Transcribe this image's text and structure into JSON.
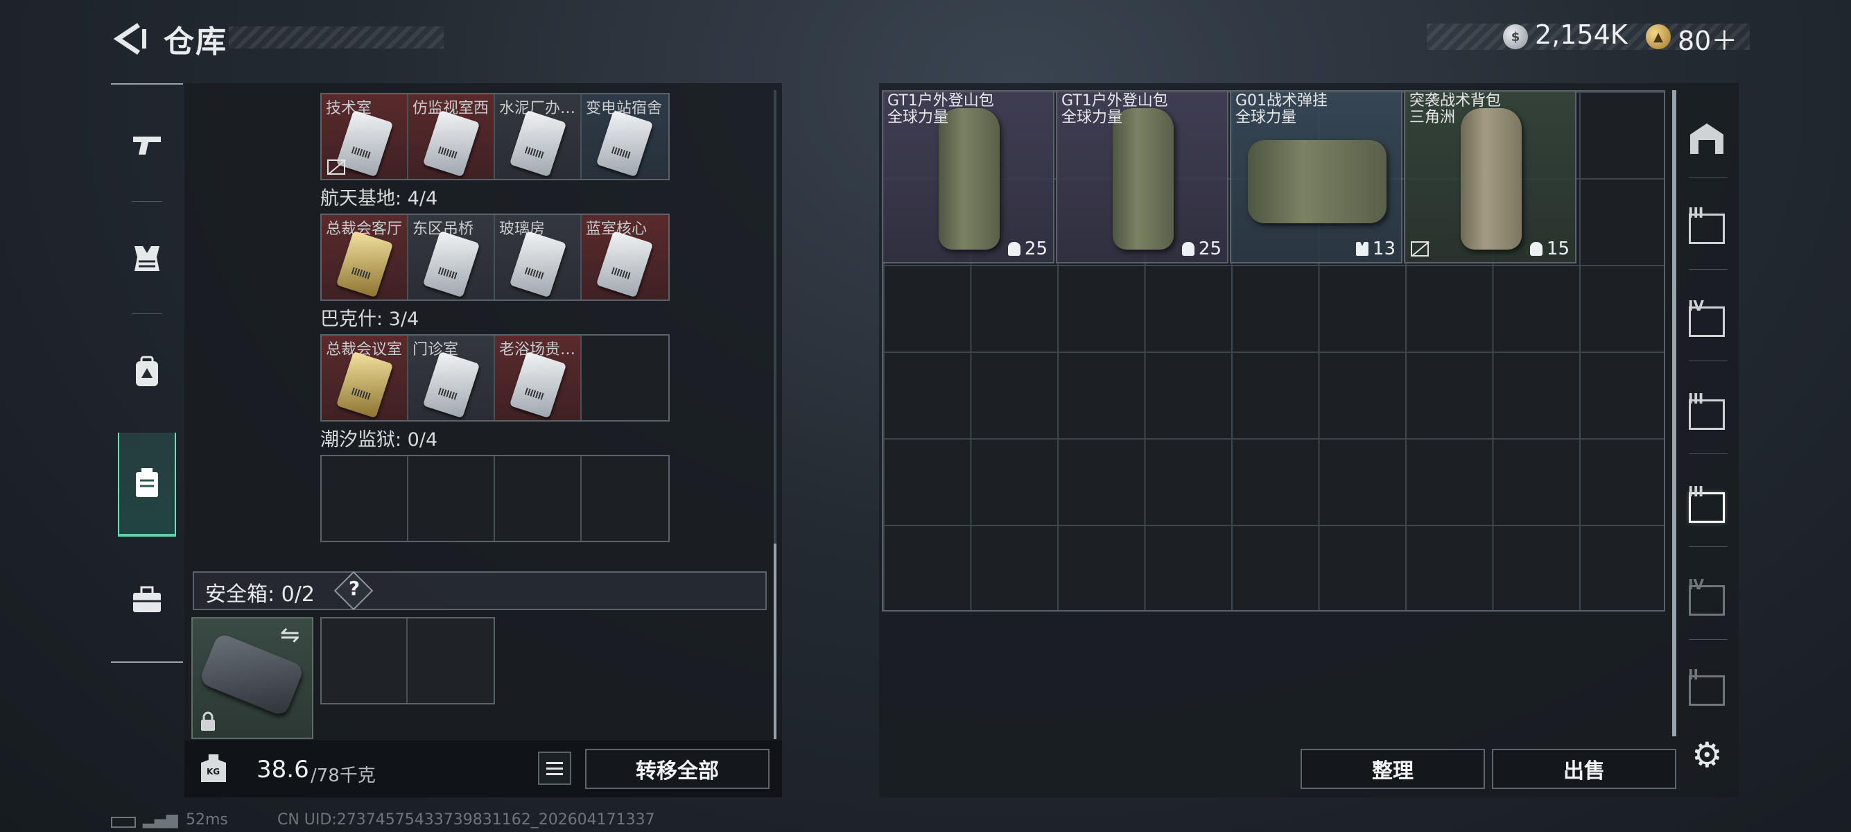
{
  "header": {
    "title": "仓库",
    "currency_silver_value": "2,154K",
    "currency_gold_value": "80＋"
  },
  "left_nav": [
    "gun-icon",
    "vest-icon",
    "backpack-icon",
    "keycard-case-icon",
    "toolbox-icon"
  ],
  "key_sections": [
    {
      "heading": "",
      "slots": [
        {
          "label": "技术室",
          "color": "red",
          "gold": false,
          "no_sell": true
        },
        {
          "label": "仿监视室西",
          "color": "red",
          "gold": false,
          "no_sell": false
        },
        {
          "label": "水泥厂办…",
          "color": "gray",
          "gold": false,
          "no_sell": false
        },
        {
          "label": "变电站宿舍",
          "color": "blue",
          "gold": false,
          "no_sell": false
        }
      ]
    },
    {
      "heading": "航天基地: 4/4",
      "slots": [
        {
          "label": "总裁会客厅",
          "color": "red",
          "gold": true
        },
        {
          "label": "东区吊桥",
          "color": "gray",
          "gold": false
        },
        {
          "label": "玻璃房",
          "color": "gray",
          "gold": false
        },
        {
          "label": "蓝室核心",
          "color": "red",
          "gold": false
        }
      ]
    },
    {
      "heading": "巴克什: 3/4",
      "slots": [
        {
          "label": "总裁会议室",
          "color": "red",
          "gold": true
        },
        {
          "label": "门诊室",
          "color": "gray",
          "gold": false
        },
        {
          "label": "老浴场贵…",
          "color": "red",
          "gold": false
        },
        {
          "label": "",
          "color": "empty",
          "gold": false
        }
      ]
    },
    {
      "heading": "潮汐监狱: 0/4",
      "slots": [
        {
          "label": "",
          "color": "empty"
        },
        {
          "label": "",
          "color": "empty"
        },
        {
          "label": "",
          "color": "empty"
        },
        {
          "label": "",
          "color": "empty"
        }
      ]
    }
  ],
  "safe_box": {
    "label": "安全箱:  0/2",
    "help": "?"
  },
  "weight": {
    "current": "38.6",
    "max": "/78千克",
    "unit_icon_text": "KG"
  },
  "buttons": {
    "transfer_all": "转移全部",
    "sort": "整理",
    "sell": "出售"
  },
  "stash_items": [
    {
      "name_line1": "GT1户外登山包",
      "name_line2": "全球力量",
      "capacity": "25",
      "color": "purple",
      "type": "backpack",
      "no_sell": false
    },
    {
      "name_line1": "GT1户外登山包",
      "name_line2": "全球力量",
      "capacity": "25",
      "color": "purple",
      "type": "backpack",
      "no_sell": false
    },
    {
      "name_line1": "G01战术弹挂",
      "name_line2": "全球力量",
      "capacity": "13",
      "color": "blue",
      "type": "vest",
      "no_sell": false
    },
    {
      "name_line1": "突袭战术背包",
      "name_line2": "三角洲",
      "capacity": "15",
      "color": "green",
      "type": "backpack",
      "no_sell": true
    }
  ],
  "side_tabs": [
    {
      "roman": "",
      "state": "normal"
    },
    {
      "roman": "III",
      "state": "normal"
    },
    {
      "roman": "IV",
      "state": "normal"
    },
    {
      "roman": "III",
      "state": "normal"
    },
    {
      "roman": "III",
      "state": "active"
    },
    {
      "roman": "IV",
      "state": "dim"
    },
    {
      "roman": "II",
      "state": "dim"
    }
  ],
  "footer": {
    "ping": "52ms",
    "uid": "CN UID:27374575433739831162_202604171337"
  }
}
